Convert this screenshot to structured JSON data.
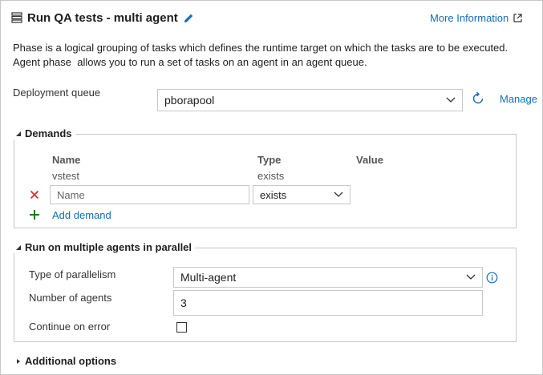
{
  "header": {
    "title": "Run QA tests - multi agent",
    "more_info_label": "More Information"
  },
  "description": {
    "line1": "Phase is a logical grouping of tasks which defines the runtime target on which the tasks are to be executed.",
    "line2": "Agent phase  allows you to run a set of tasks on an agent in an agent queue."
  },
  "deployment_queue": {
    "label": "Deployment queue",
    "value": "pborapool",
    "manage_label": "Manage"
  },
  "demands": {
    "legend": "Demands",
    "columns": [
      "Name",
      "Type",
      "Value"
    ],
    "rows": [
      {
        "name": "vstest",
        "type": "exists"
      }
    ],
    "new_row": {
      "name_placeholder": "Name",
      "type_value": "exists"
    },
    "add_label": "Add demand"
  },
  "parallel": {
    "legend": "Run on multiple agents in parallel",
    "parallelism_label": "Type of parallelism",
    "parallelism_value": "Multi-agent",
    "agents_label": "Number of agents",
    "agents_value": "3",
    "continue_label": "Continue on error",
    "continue_checked": false
  },
  "additional": {
    "legend": "Additional options"
  },
  "colors": {
    "link": "#106ebe",
    "remove": "#d13438",
    "add": "#107c10",
    "border": "#c8c8c8"
  },
  "icons": {
    "header": "phase-list-icon",
    "edit": "pencil-icon",
    "external": "external-link-icon",
    "refresh": "refresh-icon",
    "info": "info-icon",
    "remove": "close-icon",
    "add": "plus-icon"
  }
}
